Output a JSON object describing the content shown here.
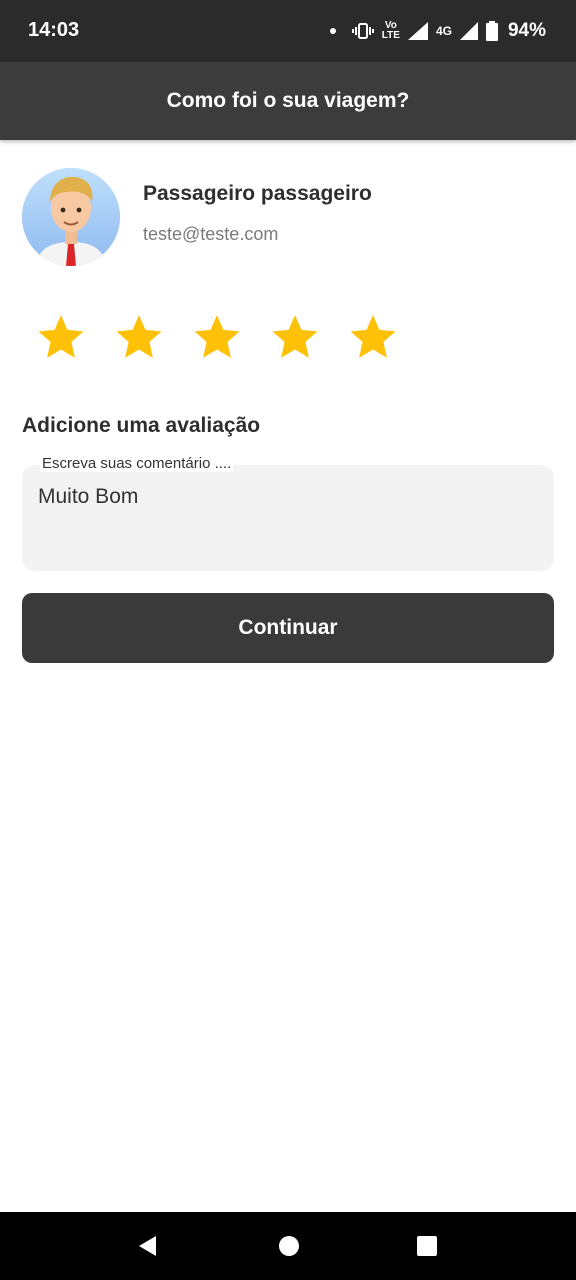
{
  "status_bar": {
    "time": "14:03",
    "volte_top": "Vo",
    "volte_bottom": "LTE",
    "network": "4G",
    "battery": "94%"
  },
  "app_bar": {
    "title": "Como foi o sua viagem?"
  },
  "user": {
    "name": "Passageiro passageiro",
    "email": "teste@teste.com",
    "avatar_icon": "avatar-cartoon-man"
  },
  "rating": {
    "value": 5,
    "max": 5,
    "star_color": "#FFC107"
  },
  "review": {
    "title": "Adicione uma avaliação",
    "label": "Escreva suas comentário ....",
    "value": "Muito Bom"
  },
  "continue_label": "Continuar",
  "nav": {
    "icons": [
      "back-icon",
      "home-icon",
      "recents-icon"
    ]
  }
}
